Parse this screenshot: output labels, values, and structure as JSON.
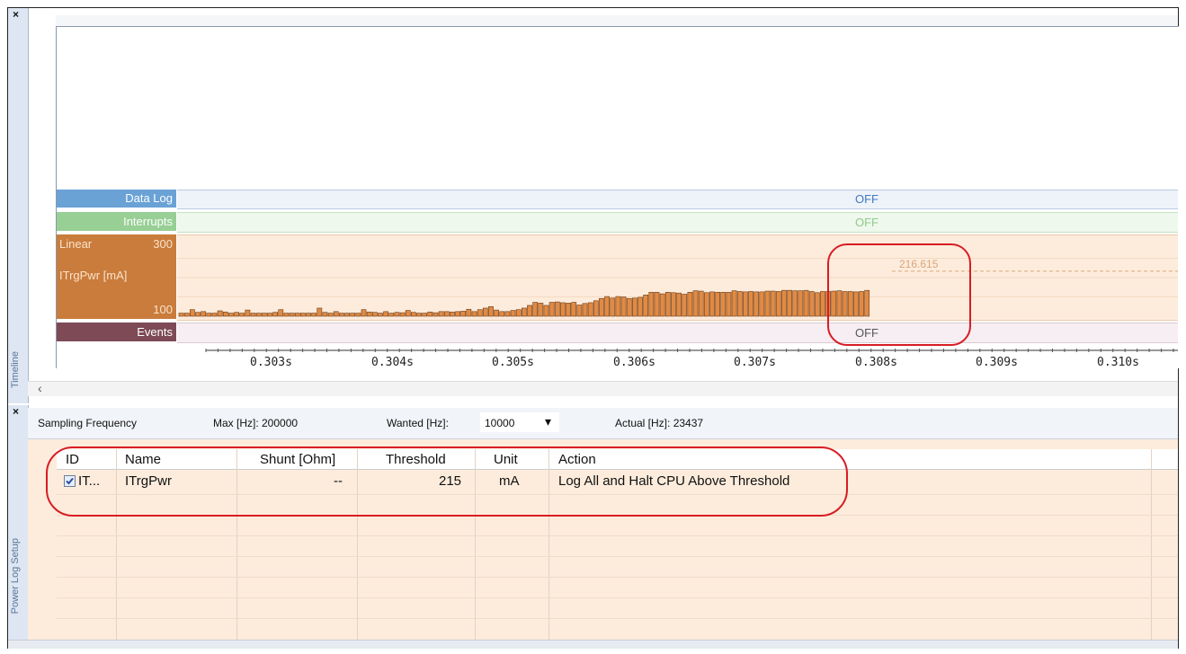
{
  "timeline_panel": {
    "close_glyph": "×",
    "side_label": "Timeline",
    "data_log": {
      "label": "Data Log",
      "status": "OFF",
      "color": "#6aa2d6"
    },
    "interrupts": {
      "label": "Interrupts",
      "status": "OFF",
      "color": "#97cf95"
    },
    "power_graph": {
      "scale_mode": "Linear",
      "y_max_label": "300",
      "y_min_label": "100",
      "channel_label": "ITrgPwr [mA]",
      "threshold_marker": "216.615",
      "color": "#c97c3c"
    },
    "events": {
      "label": "Events",
      "status": "OFF",
      "color": "#7d4a56"
    },
    "time_axis": [
      "0.303s",
      "0.304s",
      "0.305s",
      "0.306s",
      "0.307s",
      "0.308s",
      "0.309s",
      "0.310s"
    ],
    "scroll_left_glyph": "‹"
  },
  "chart_data": {
    "type": "bar",
    "title": "",
    "xlabel": "",
    "ylabel": "ITrgPwr [mA]",
    "ylim": [
      100,
      300
    ],
    "x_range": [
      "0.3025s",
      "0.3081s"
    ],
    "threshold": 216.615,
    "values": [
      108,
      108,
      117,
      110,
      112,
      108,
      108,
      114,
      111,
      108,
      110,
      108,
      116,
      108,
      108,
      108,
      108,
      110,
      117,
      108,
      108,
      108,
      108,
      108,
      108,
      121,
      110,
      108,
      112,
      108,
      108,
      108,
      108,
      117,
      111,
      110,
      108,
      112,
      108,
      110,
      109,
      115,
      110,
      108,
      108,
      111,
      109,
      112,
      112,
      111,
      112,
      113,
      118,
      112,
      117,
      121,
      125,
      116,
      112,
      112,
      115,
      117,
      121,
      128,
      136,
      134,
      128,
      136,
      137,
      135,
      134,
      136,
      129,
      133,
      135,
      140,
      146,
      151,
      147,
      151,
      150,
      146,
      147,
      149,
      155,
      162,
      162,
      158,
      162,
      161,
      160,
      157,
      162,
      166,
      165,
      161,
      163,
      162,
      162,
      162,
      166,
      164,
      163,
      164,
      163,
      163,
      165,
      165,
      164,
      167,
      167,
      166,
      166,
      167,
      164,
      161,
      164,
      164,
      165,
      166,
      164,
      164,
      163,
      164,
      167
    ]
  },
  "power_log_setup": {
    "close_glyph": "×",
    "side_label": "Power Log Setup",
    "sampling_frequency_label": "Sampling Frequency",
    "max_hz": "Max [Hz]: 200000",
    "wanted_label": "Wanted [Hz]:",
    "wanted_value": "10000",
    "dropdown_glyph": "▾",
    "actual_hz": "Actual [Hz]: 23437",
    "columns": [
      "ID",
      "Name",
      "Shunt [Ohm]",
      "Threshold",
      "Unit",
      "Action"
    ],
    "rows": [
      {
        "checked": true,
        "id": "IT...",
        "name": "ITrgPwr",
        "shunt": "--",
        "threshold": "215",
        "unit": "mA",
        "action": "Log All and Halt CPU Above Threshold"
      }
    ]
  },
  "colors": {
    "annotation": "#d81c24",
    "panel_bg": "#fdecdc",
    "sidebar": "#dde6f2"
  }
}
